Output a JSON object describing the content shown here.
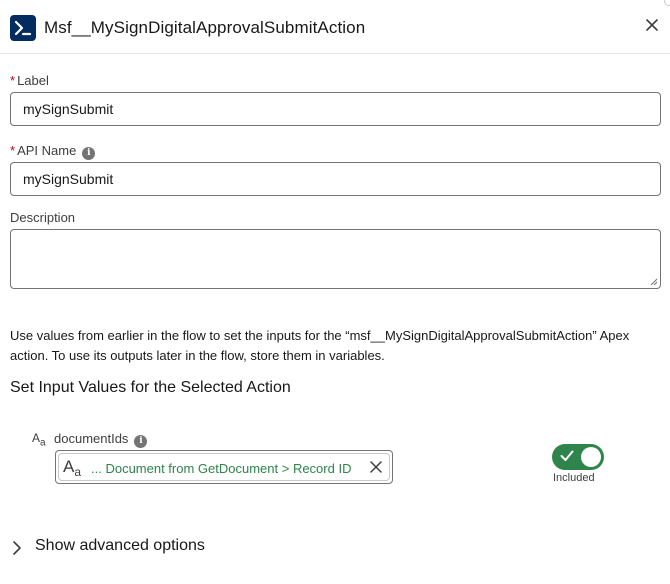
{
  "header": {
    "title": "Msf__MySignDigitalApprovalSubmitAction",
    "icon": "apex-action-icon",
    "close_icon": "close-icon"
  },
  "form": {
    "label": {
      "required_mark": "*",
      "label": "Label",
      "value": "mySignSubmit"
    },
    "api_name": {
      "required_mark": "*",
      "label": "API Name",
      "info": "i",
      "value": "mySignSubmit"
    },
    "description": {
      "label": "Description",
      "value": ""
    }
  },
  "help_text": "Use values from earlier in the flow to set the inputs for the “msf__MySignDigitalApprovalSubmitAction” Apex action. To use its outputs later in the flow, store them in variables.",
  "section_title": "Set Input Values for the Selected Action",
  "inputs": [
    {
      "type_icon": "A",
      "type_icon_sub": "a",
      "name": "documentIds",
      "info": "i",
      "pill": {
        "type_icon": "A",
        "type_icon_sub": "a",
        "text": "... Document from GetDocument > Record ID"
      },
      "toggle": {
        "on": true,
        "label": "Included"
      }
    }
  ],
  "advanced": {
    "label": "Show advanced options",
    "expanded": false
  },
  "colors": {
    "brand": "#032d60",
    "required": "#ba0517",
    "success": "#2e844a",
    "border": "#747474"
  }
}
